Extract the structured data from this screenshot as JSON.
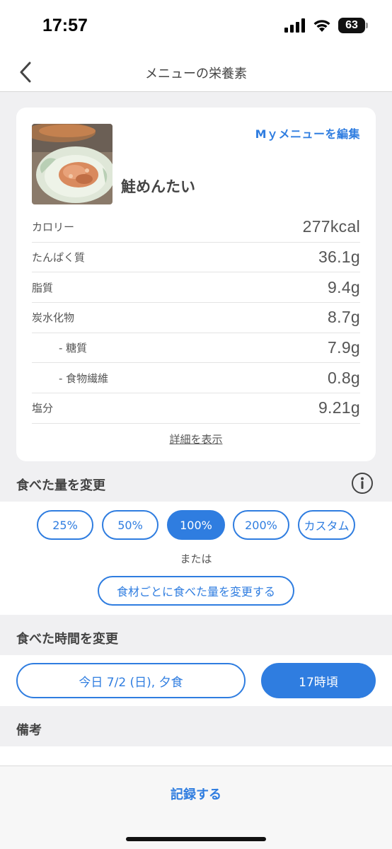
{
  "status": {
    "time": "17:57",
    "battery": "63"
  },
  "nav": {
    "title": "メニューの栄養素"
  },
  "card": {
    "edit_link": "Mｙメニューを編集",
    "menu_name": "鮭めんたい",
    "nutrition": [
      {
        "label": "カロリー",
        "value": "277kcal"
      },
      {
        "label": "たんぱく質",
        "value": "36.1g"
      },
      {
        "label": "脂質",
        "value": "9.4g"
      },
      {
        "label": "炭水化物",
        "value": "8.7g"
      },
      {
        "label": "- 糖質",
        "value": "7.9g"
      },
      {
        "label": "- 食物繊維",
        "value": "0.8g"
      },
      {
        "label": "塩分",
        "value": "9.21g"
      }
    ],
    "detail_link": "詳細を表示"
  },
  "amount": {
    "title": "食べた量を変更",
    "options": [
      "25%",
      "50%",
      "100%",
      "200%",
      "カスタム"
    ],
    "selected": "100%",
    "or_text": "または",
    "per_ingredient_button": "食材ごとに食べた量を変更する"
  },
  "time_section": {
    "title": "食べた時間を変更",
    "date_button": "今日 7/2 (日), 夕食",
    "time_button": "17時頃"
  },
  "notes": {
    "title": "備考"
  },
  "bottom": {
    "record_button": "記録する"
  },
  "colors": {
    "accent": "#2f7de0",
    "background": "#f0f0f2"
  }
}
